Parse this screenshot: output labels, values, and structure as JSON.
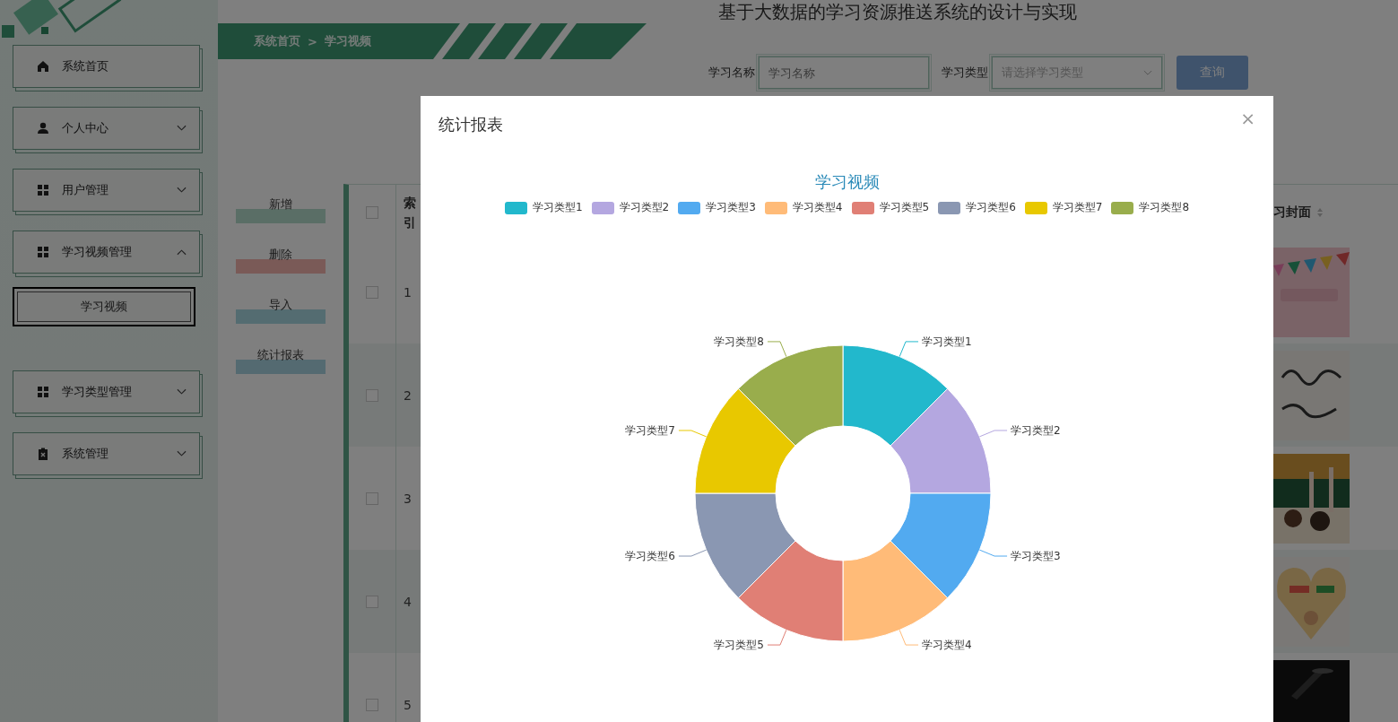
{
  "page_title": "基于大数据的学习资源推送系统的设计与实现",
  "sidebar": {
    "items": [
      {
        "label": "系统首页"
      },
      {
        "label": "个人中心",
        "expanded": false
      },
      {
        "label": "用户管理",
        "expanded": false
      },
      {
        "label": "学习视频管理",
        "expanded": true,
        "children": [
          {
            "label": "学习视频",
            "selected": true
          }
        ]
      },
      {
        "label": "学习类型管理",
        "expanded": false
      },
      {
        "label": "系统管理",
        "expanded": false
      }
    ]
  },
  "breadcrumb": {
    "home": "系统首页",
    "separator": ">",
    "current": "学习视频"
  },
  "search": {
    "fields": [
      {
        "kind": "input",
        "label": "学习名称",
        "placeholder": "学习名称"
      },
      {
        "kind": "select",
        "label": "学习类型",
        "placeholder": "请选择学习类型"
      }
    ],
    "button": "查询"
  },
  "actions": [
    {
      "label": "新增",
      "color": "#5a6e66"
    },
    {
      "label": "删除",
      "color": "#7a5a57"
    },
    {
      "label": "导入",
      "color": "#546c71"
    },
    {
      "label": "统计报表",
      "color": "#546a71"
    }
  ],
  "table": {
    "header_checked": false,
    "columns": [
      "索引",
      "习封面"
    ],
    "rows": [
      {
        "index": "1",
        "checked": false
      },
      {
        "index": "2",
        "checked": false
      },
      {
        "index": "3",
        "checked": false
      },
      {
        "index": "4",
        "checked": false
      },
      {
        "index": "5",
        "checked": false
      }
    ]
  },
  "modal": {
    "title": "统计报表",
    "close": "×",
    "legend": [
      {
        "label": "学习类型1",
        "color": "#22b8cc"
      },
      {
        "label": "学习类型2",
        "color": "#b4a7e0"
      },
      {
        "label": "学习类型3",
        "color": "#52aaf0"
      },
      {
        "label": "学习类型4",
        "color": "#ffbb78"
      },
      {
        "label": "学习类型5",
        "color": "#e07f75"
      },
      {
        "label": "学习类型6",
        "color": "#8a97b2"
      },
      {
        "label": "学习类型7",
        "color": "#e8c800"
      },
      {
        "label": "学习类型8",
        "color": "#99ad4c"
      }
    ],
    "chart_data": {
      "type": "donut",
      "title": "学习视频",
      "categories": [
        "学习类型1",
        "学习类型2",
        "学习类型3",
        "学习类型4",
        "学习类型5",
        "学习类型6",
        "学习类型7",
        "学习类型8"
      ],
      "values": [
        1,
        1,
        1,
        1,
        1,
        1,
        1,
        1
      ]
    }
  }
}
